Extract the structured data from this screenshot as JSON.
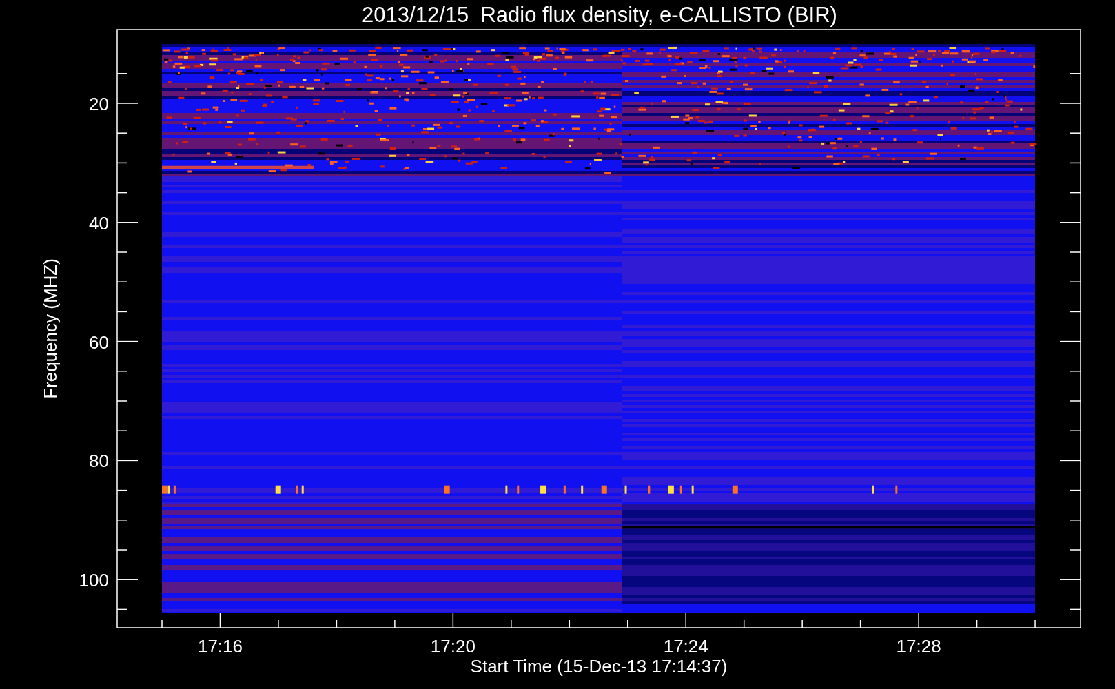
{
  "plot": {
    "title": "2013/12/15  Radio flux density, e-CALLISTO (BIR)",
    "y_axis": {
      "label": "Frequency (MHZ)",
      "ticks": [
        "20",
        "40",
        "60",
        "80",
        "100"
      ]
    },
    "x_axis": {
      "label": "Start Time (15-Dec-13 17:14:37)",
      "ticks": [
        "17:16",
        "17:20",
        "17:24",
        "17:28"
      ]
    }
  }
}
